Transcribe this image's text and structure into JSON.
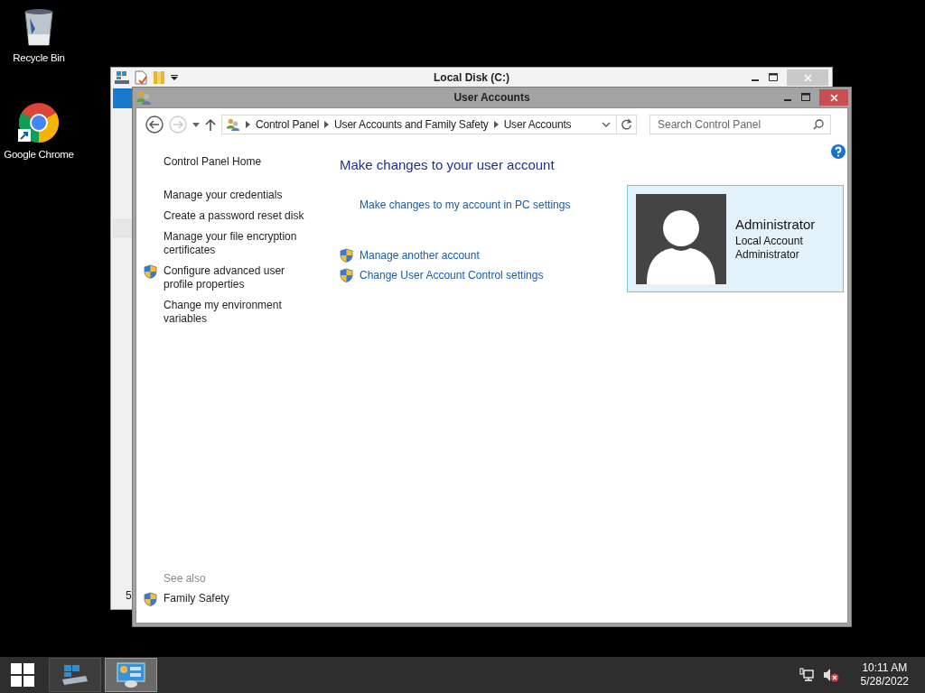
{
  "desktop_icons": [
    {
      "label": "Recycle Bin",
      "kind": "recycle"
    },
    {
      "label": "Google Chrome",
      "kind": "chrome"
    }
  ],
  "back_window": {
    "title": "Local Disk (C:)",
    "fragment": "5"
  },
  "window": {
    "title": "User Accounts",
    "address": {
      "crumbs": [
        "Control Panel",
        "User Accounts and Family Safety",
        "User Accounts"
      ]
    },
    "search": {
      "placeholder": "Search Control Panel"
    },
    "sidebar": {
      "items": [
        {
          "label": "Control Panel Home",
          "shield": false
        },
        {
          "label": "Manage your credentials",
          "shield": false
        },
        {
          "label": "Create a password reset disk",
          "shield": false
        },
        {
          "label": "Manage your file encryption certificates",
          "shield": false
        },
        {
          "label": "Configure advanced user profile properties",
          "shield": true
        },
        {
          "label": "Change my environment variables",
          "shield": false
        }
      ],
      "see_also": {
        "heading": "See also",
        "items": [
          {
            "label": "Family Safety",
            "shield": true
          }
        ]
      }
    },
    "main": {
      "heading": "Make changes to your user account",
      "link_groups": [
        [
          {
            "label": "Make changes to my account in PC settings",
            "shield": false
          }
        ],
        [
          {
            "label": "Manage another account",
            "shield": true
          },
          {
            "label": "Change User Account Control settings",
            "shield": true
          }
        ]
      ]
    },
    "account": {
      "name": "Administrator",
      "lines": [
        "Local Account",
        "Administrator"
      ]
    }
  },
  "taskbar": {
    "items": [
      {
        "kind": "explorer",
        "selected": false
      },
      {
        "kind": "control_panel",
        "selected": true
      }
    ],
    "tray": {
      "volume_muted": true
    },
    "clock": {
      "time": "10:11 AM",
      "date": "5/28/2022"
    }
  }
}
